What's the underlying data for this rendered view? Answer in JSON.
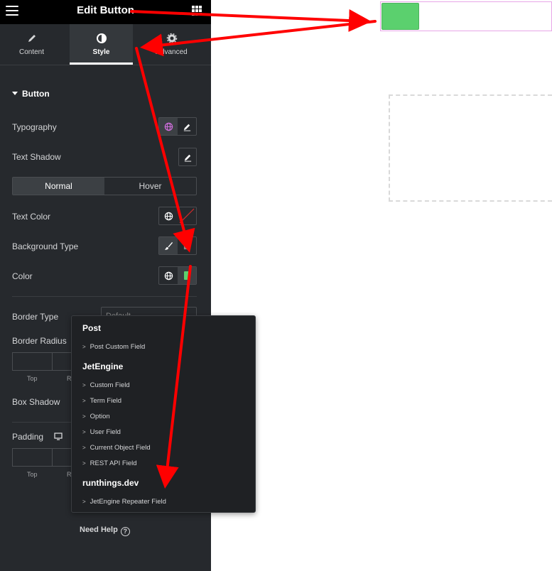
{
  "topbar": {
    "title": "Edit Button"
  },
  "tabs": [
    {
      "label": "Content",
      "icon": "pencil-icon"
    },
    {
      "label": "Style",
      "icon": "half-circle-icon"
    },
    {
      "label": "Advanced",
      "icon": "gear-icon"
    }
  ],
  "section": {
    "title": "Button"
  },
  "rows": {
    "typography": "Typography",
    "text_shadow": "Text Shadow",
    "text_color": "Text Color",
    "background_type": "Background Type",
    "color": "Color",
    "border_type": "Border Type",
    "border_radius": "Border Radius",
    "box_shadow": "Box Shadow",
    "padding": "Padding"
  },
  "state_toggle": {
    "normal": "Normal",
    "hover": "Hover"
  },
  "border_type_value": "Default",
  "dimension_labels": {
    "top": "Top",
    "right_partial": "R"
  },
  "colors": {
    "accent_button": "#5bd06e",
    "arrow": "#ff0000",
    "panel_bg": "#26292d"
  },
  "dynamic_popup": {
    "groups": [
      {
        "title": "Post",
        "items": [
          "Post Custom Field"
        ]
      },
      {
        "title": "JetEngine",
        "items": [
          "Custom Field",
          "Term Field",
          "Option",
          "User Field",
          "Current Object Field",
          "REST API Field"
        ]
      },
      {
        "title": "runthings.dev",
        "items": [
          "JetEngine Repeater Field"
        ]
      }
    ]
  },
  "footer": {
    "need_help": "Need Help",
    "help_symbol": "?"
  }
}
